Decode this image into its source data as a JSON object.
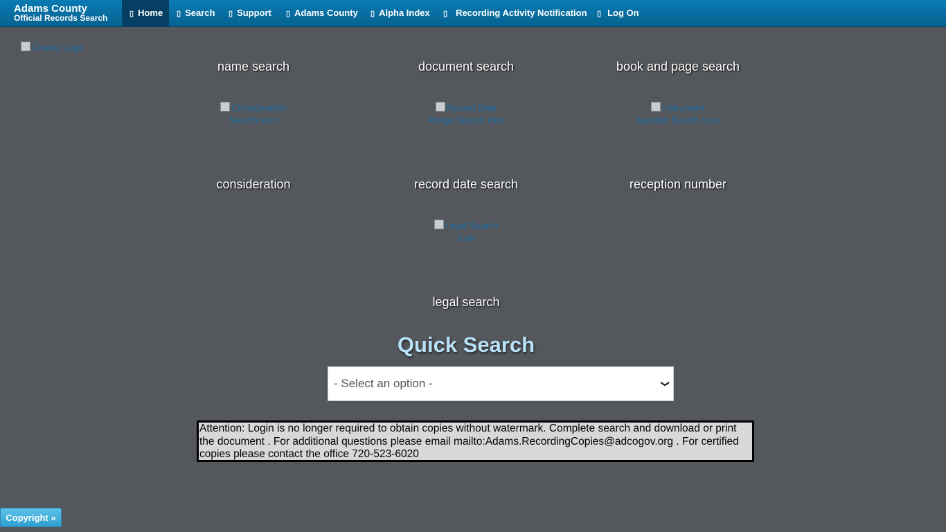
{
  "brand": {
    "line1": "Adams County",
    "line2": "Official Records Search"
  },
  "nav": [
    {
      "label": "Home",
      "icon": "home-icon",
      "active": true
    },
    {
      "label": "Search",
      "icon": "search-icon"
    },
    {
      "label": "Support",
      "icon": "support-icon"
    },
    {
      "label": "Adams County",
      "icon": "building-icon"
    },
    {
      "label": "Alpha Index",
      "icon": "list-icon"
    },
    {
      "label": "Recording Activity Notification",
      "icon": "bell-icon"
    },
    {
      "label": "Log On",
      "icon": "user-icon"
    }
  ],
  "logo_alt": "County Logo",
  "tiles": {
    "name_search": "name search",
    "document_search": "document search",
    "book_page_search": "book and page search",
    "consideration_alt": "Consideration Search Icon",
    "record_date_alt": "Record Date Range Search Icon",
    "instrument_alt": "Instrument Number Search Icon",
    "consideration": "consideration",
    "record_date_search": "record date search",
    "reception_number": "reception number",
    "legal_alt": "Legal Search Icon",
    "legal_search": "legal search"
  },
  "quick_search": {
    "title": "Quick Search",
    "selected": "- Select an option -"
  },
  "attention": "Attention: Login is no longer required to obtain copies without watermark. Complete search and download or print the document . For additional questions please email mailto:Adams.RecordingCopies@adcogov.org . For certified copies please contact the office 720-523-6020",
  "footer": {
    "copyright": "Copyright »"
  },
  "colors": {
    "background": "#54575c",
    "navbar": "#0a7bb4",
    "quick_search_title": "#b7e1f7"
  }
}
